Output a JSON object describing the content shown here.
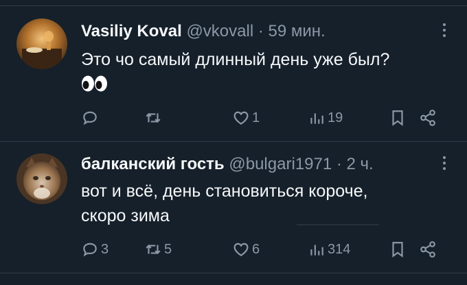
{
  "tweets": [
    {
      "author_name": "Vasiliy Koval",
      "handle": "@vkovall",
      "separator": "·",
      "time": "59 мин.",
      "text": [
        "Это чо самый длинный день уже был?"
      ],
      "emoji": "eyes",
      "replies": "",
      "retweets": "",
      "likes": "1",
      "views": "19"
    },
    {
      "author_name": "балканский гость",
      "handle": "@bulgari1971",
      "separator": "·",
      "time": "2 ч.",
      "text": [
        "вот и всё, день становиться короче,",
        "скоро зима"
      ],
      "replies": "3",
      "retweets": "5",
      "likes": "6",
      "views": "314"
    }
  ],
  "colors": {
    "background": "#15202b",
    "text": "#f7f9f9",
    "muted": "#8b98a5",
    "divider": "#2f3b47"
  },
  "icons": [
    "reply-icon",
    "retweet-icon",
    "like-icon",
    "views-icon",
    "bookmark-icon",
    "share-icon",
    "more-icon"
  ]
}
